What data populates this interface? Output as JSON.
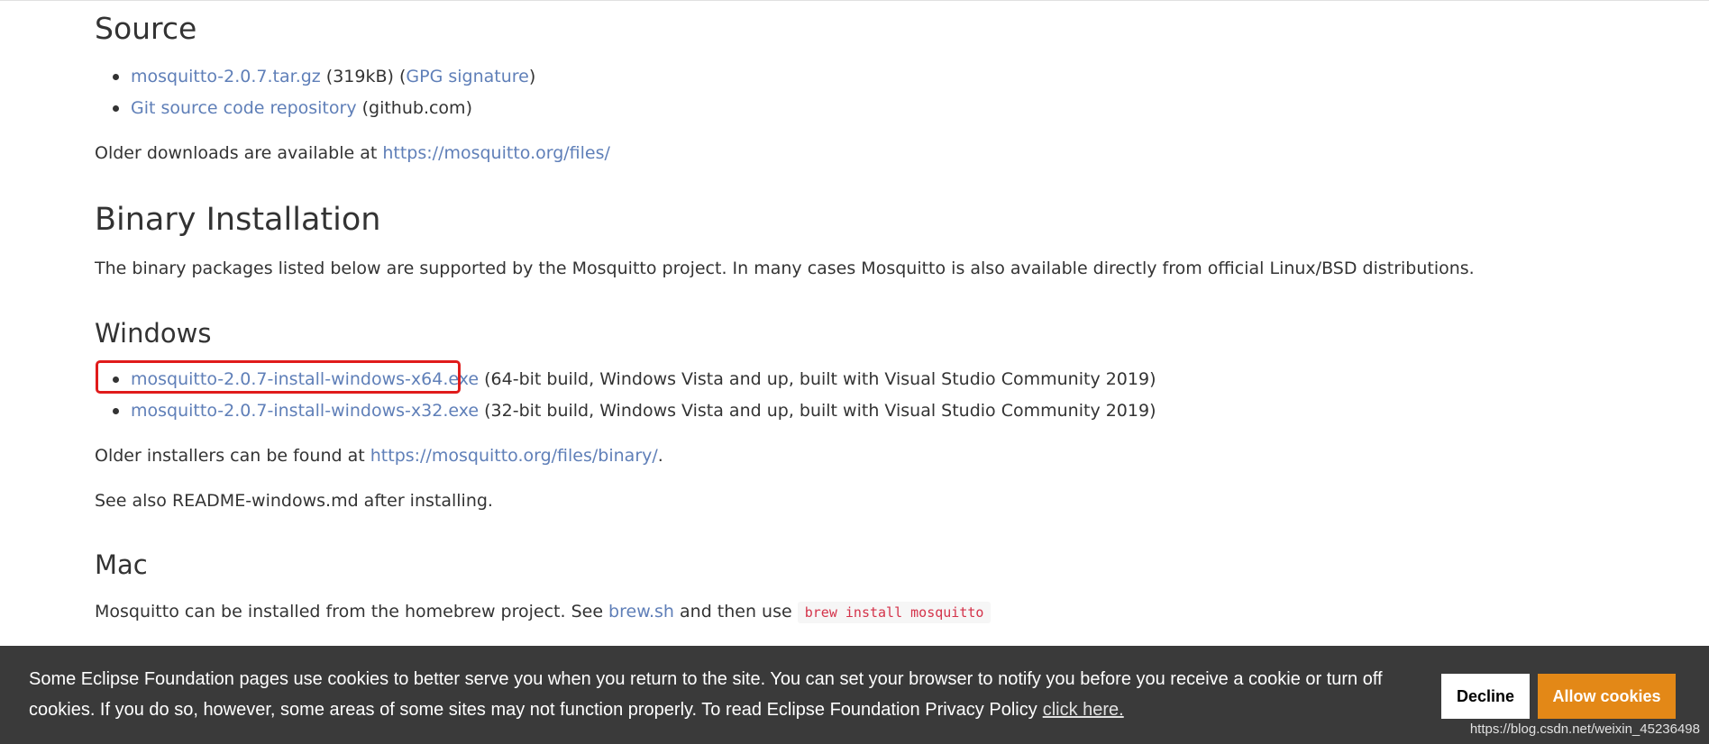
{
  "source": {
    "heading": "Source",
    "items": [
      {
        "link": "mosquitto-2.0.7.tar.gz",
        "size": " (319kB) (",
        "sig_link": "GPG signature",
        "close": ")"
      },
      {
        "link": "Git source code repository",
        "suffix": " (github.com)"
      }
    ],
    "older_text": "Older downloads are available at ",
    "older_link": "https://mosquitto.org/files/"
  },
  "binary": {
    "heading": "Binary Installation",
    "description": "The binary packages listed below are supported by the Mosquitto project. In many cases Mosquitto is also available directly from official Linux/BSD distributions."
  },
  "windows": {
    "heading": "Windows",
    "items": [
      {
        "link": "mosquitto-2.0.7-install-windows-x64.exe",
        "suffix": " (64-bit build, Windows Vista and up, built with Visual Studio Community 2019)"
      },
      {
        "link": "mosquitto-2.0.7-install-windows-x32.exe",
        "suffix": " (32-bit build, Windows Vista and up, built with Visual Studio Community 2019)"
      }
    ],
    "older_text": "Older installers can be found at ",
    "older_link": "https://mosquitto.org/files/binary/",
    "older_end": ".",
    "see_also": "See also README-windows.md after installing."
  },
  "mac": {
    "heading": "Mac",
    "text_before": "Mosquitto can be installed from the homebrew project. See ",
    "link": "brew.sh",
    "text_after": " and then use ",
    "code": "brew install mosquitto"
  },
  "cookie": {
    "text": "Some Eclipse Foundation pages use cookies to better serve you when you return to the site. You can set your browser to notify you before you receive a cookie or turn off cookies. If you do so, however, some areas of some sites may not function properly. To read Eclipse Foundation Privacy Policy",
    "link": "click here.",
    "decline": "Decline",
    "allow": "Allow cookies"
  },
  "watermark": "https://blog.csdn.net/weixin_45236498",
  "colors": {
    "link": "#5f7fb8",
    "highlight": "#e01b1b",
    "cookie_bg": "#3a3a3a",
    "allow_button": "#e38817"
  }
}
